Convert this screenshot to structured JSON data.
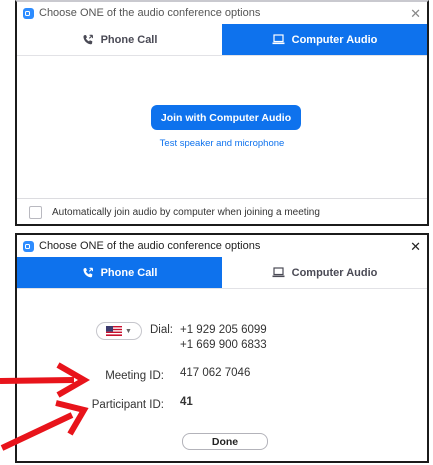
{
  "dialog_top": {
    "title": "Choose ONE of the audio conference options",
    "tabs": [
      {
        "label": "Phone Call",
        "active": false
      },
      {
        "label": "Computer Audio",
        "active": true
      }
    ],
    "join_button": "Join with Computer Audio",
    "test_link": "Test speaker and microphone",
    "auto_join_label": "Automatically join audio by computer when joining a meeting",
    "auto_join_checked": false
  },
  "dialog_bottom": {
    "title": "Choose ONE of the audio conference options",
    "tabs": [
      {
        "label": "Phone Call",
        "active": true
      },
      {
        "label": "Computer Audio",
        "active": false
      }
    ],
    "dial_label": "Dial:",
    "dial_numbers": [
      "+1 929 205 6099",
      "+1 669 900 6833"
    ],
    "meeting_id_label": "Meeting ID:",
    "meeting_id": "417 062 7046",
    "participant_id_label": "Participant ID:",
    "participant_id": "41",
    "done_button": "Done"
  },
  "colors": {
    "accent": "#0e72ed",
    "annotation_arrow": "#e8141b"
  },
  "icons": [
    "app-icon",
    "phone-icon",
    "laptop-icon",
    "close-icon",
    "us-flag-icon",
    "chevron-down-icon",
    "red-arrow"
  ]
}
